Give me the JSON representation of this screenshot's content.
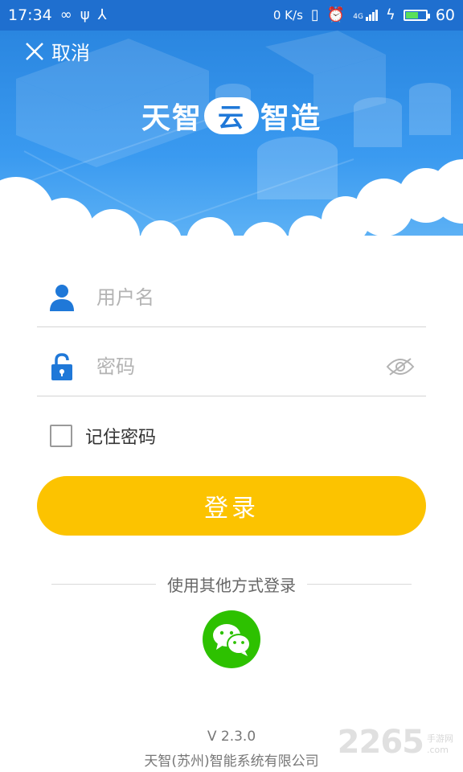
{
  "status_bar": {
    "time": "17:34",
    "net_speed": "0 K/s",
    "signal_label": "4G",
    "battery": "60",
    "battery_fraction": 0.6
  },
  "header": {
    "cancel_label": "取消",
    "logo_left": "天智",
    "logo_cloud": "云",
    "logo_right": "智造"
  },
  "form": {
    "username_placeholder": "用户名",
    "password_placeholder": "密码",
    "remember_label": "记住密码",
    "login_label": "登录"
  },
  "alt_login": {
    "label": "使用其他方式登录"
  },
  "footer": {
    "version": "V 2.3.0",
    "company": "天智(苏州)智能系统有限公司"
  },
  "watermark": {
    "number": "2265",
    "site_top": "手游网",
    "site_bottom": ".com"
  },
  "colors": {
    "header_blue": "#2a86e0",
    "login_yellow": "#fcc300",
    "icon_blue": "#1f78d8",
    "wechat_green": "#2dc100"
  },
  "icons": [
    "infinity-icon",
    "usb-icon",
    "share-icon",
    "vibrate-icon",
    "alarm-icon",
    "signal-icon",
    "charging-icon",
    "battery-icon",
    "close-icon",
    "user-icon",
    "lock-icon",
    "eye-icon",
    "wechat-icon"
  ]
}
